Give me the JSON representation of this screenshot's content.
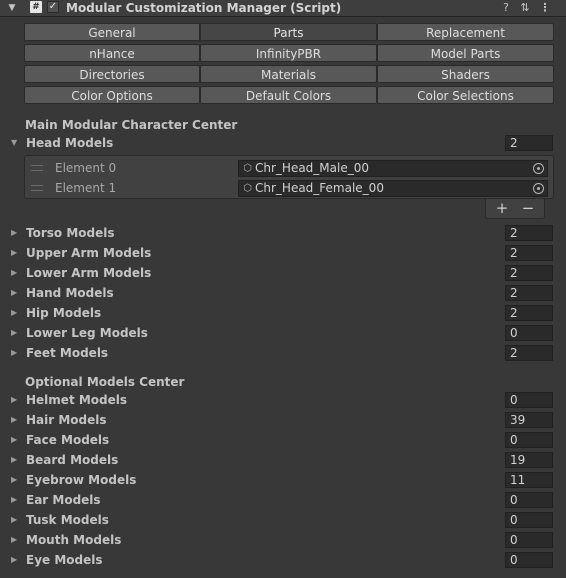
{
  "header": {
    "title": "Modular Customization Manager (Script)",
    "enabled": "✓",
    "icons": [
      "foldout-arrow",
      "script-icon",
      "help-icon",
      "preset-icon",
      "more-icon"
    ]
  },
  "tabs": [
    [
      "General",
      "Parts",
      "Replacement"
    ],
    [
      "nHance",
      "InfinityPBR",
      "Model Parts"
    ],
    [
      "Directories",
      "Materials",
      "Shaders"
    ],
    [
      "Color Options",
      "Default Colors",
      "Color Selections"
    ]
  ],
  "active_tab": "Parts",
  "main_section": {
    "label": "Main Modular Character Center",
    "head_models": {
      "label": "Head Models",
      "count": "2",
      "elements": [
        {
          "label": "Element 0",
          "value": "Chr_Head_Male_00"
        },
        {
          "label": "Element 1",
          "value": "Chr_Head_Female_00"
        }
      ],
      "add_label": "+",
      "remove_label": "−"
    },
    "rows": [
      {
        "label": "Torso Models",
        "count": "2"
      },
      {
        "label": "Upper Arm Models",
        "count": "2"
      },
      {
        "label": "Lower Arm Models",
        "count": "2"
      },
      {
        "label": "Hand Models",
        "count": "2"
      },
      {
        "label": "Hip Models",
        "count": "2"
      },
      {
        "label": "Lower Leg Models",
        "count": "0"
      },
      {
        "label": "Feet Models",
        "count": "2"
      }
    ]
  },
  "optional_section": {
    "label": "Optional Models Center",
    "rows": [
      {
        "label": "Helmet Models",
        "count": "0"
      },
      {
        "label": "Hair Models",
        "count": "39"
      },
      {
        "label": "Face Models",
        "count": "0"
      },
      {
        "label": "Beard Models",
        "count": "19"
      },
      {
        "label": "Eyebrow Models",
        "count": "11"
      },
      {
        "label": "Ear Models",
        "count": "0"
      },
      {
        "label": "Tusk Models",
        "count": "0"
      },
      {
        "label": "Mouth Models",
        "count": "0"
      },
      {
        "label": "Eye Models",
        "count": "0"
      }
    ]
  },
  "colors": {
    "background": "#383838",
    "button": "#585858",
    "button_active": "#464646",
    "field": "#2a2a2a",
    "text": "#c4c4c4"
  }
}
